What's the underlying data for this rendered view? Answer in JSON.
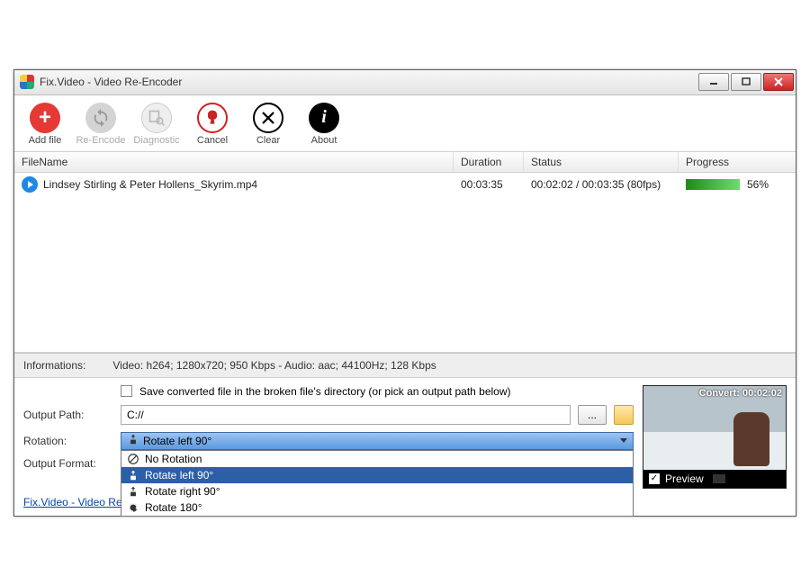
{
  "window": {
    "title": "Fix.Video - Video Re-Encoder"
  },
  "toolbar": {
    "add": "Add file",
    "reencode": "Re-Encode",
    "diagnostic": "Diagnostic",
    "cancel": "Cancel",
    "clear": "Clear",
    "about": "About"
  },
  "columns": {
    "filename": "FileName",
    "duration": "Duration",
    "status": "Status",
    "progress": "Progress"
  },
  "files": [
    {
      "name": "Lindsey Stirling  & Peter Hollens_Skyrim.mp4",
      "duration": "00:03:35",
      "status": "00:02:02 / 00:03:35 (80fps)",
      "progress_pct": "56%"
    }
  ],
  "info": {
    "label": "Informations:",
    "text": "Video: h264; 1280x720; 950 Kbps - Audio: aac; 44100Hz; 128 Kbps"
  },
  "form": {
    "save_checkbox": "Save converted file in the broken file's directory (or pick an output path below)",
    "output_path_label": "Output Path:",
    "output_path_value": "C://",
    "browse": "...",
    "rotation_label": "Rotation:",
    "rotation_selected": "Rotate left 90°",
    "rotation_options": {
      "none": "No Rotation",
      "left": "Rotate left 90°",
      "right": "Rotate right 90°",
      "r180": "Rotate 180°"
    },
    "output_format_label": "Output Format:"
  },
  "preview": {
    "convert_label": "Convert: 00:02:02",
    "checkbox_label": "Preview"
  },
  "footer_link": "Fix.Video - Video Re"
}
